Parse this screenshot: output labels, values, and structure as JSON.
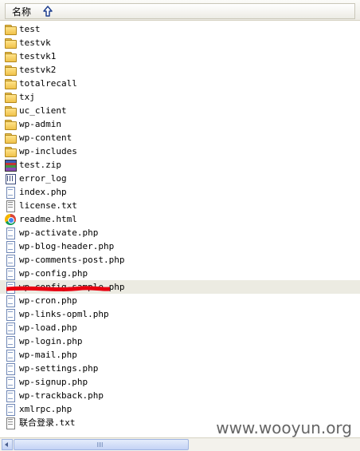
{
  "header": {
    "column_name": "名称",
    "sort_icon": "arrow-up-icon"
  },
  "files": [
    {
      "name": "test",
      "icon": "folder-icon"
    },
    {
      "name": "testvk",
      "icon": "folder-icon"
    },
    {
      "name": "testvk1",
      "icon": "folder-icon"
    },
    {
      "name": "testvk2",
      "icon": "folder-icon"
    },
    {
      "name": "totalrecall",
      "icon": "folder-icon"
    },
    {
      "name": "txj",
      "icon": "folder-icon"
    },
    {
      "name": "uc_client",
      "icon": "folder-icon"
    },
    {
      "name": "wp-admin",
      "icon": "folder-icon"
    },
    {
      "name": "wp-content",
      "icon": "folder-icon"
    },
    {
      "name": "wp-includes",
      "icon": "folder-icon"
    },
    {
      "name": "test.zip",
      "icon": "zip-archive-icon"
    },
    {
      "name": "error_log",
      "icon": "log-file-icon"
    },
    {
      "name": "index.php",
      "icon": "php-file-icon"
    },
    {
      "name": "license.txt",
      "icon": "text-file-icon"
    },
    {
      "name": "readme.html",
      "icon": "browser-icon"
    },
    {
      "name": "wp-activate.php",
      "icon": "php-file-icon"
    },
    {
      "name": "wp-blog-header.php",
      "icon": "php-file-icon"
    },
    {
      "name": "wp-comments-post.php",
      "icon": "php-file-icon"
    },
    {
      "name": "wp-config.php",
      "icon": "php-file-icon"
    },
    {
      "name": "wp-config-sample.php",
      "icon": "php-file-icon",
      "selected": true,
      "redacted": true
    },
    {
      "name": "wp-cron.php",
      "icon": "php-file-icon"
    },
    {
      "name": "wp-links-opml.php",
      "icon": "php-file-icon"
    },
    {
      "name": "wp-load.php",
      "icon": "php-file-icon"
    },
    {
      "name": "wp-login.php",
      "icon": "php-file-icon"
    },
    {
      "name": "wp-mail.php",
      "icon": "php-file-icon"
    },
    {
      "name": "wp-settings.php",
      "icon": "php-file-icon"
    },
    {
      "name": "wp-signup.php",
      "icon": "php-file-icon"
    },
    {
      "name": "wp-trackback.php",
      "icon": "php-file-icon"
    },
    {
      "name": "xmlrpc.php",
      "icon": "php-file-icon"
    },
    {
      "name": "联合登录.txt",
      "icon": "text-file-icon"
    }
  ],
  "watermark": "www.wooyun.org",
  "colors": {
    "selection": "#ecebe2",
    "redaction": "#e8000f"
  }
}
